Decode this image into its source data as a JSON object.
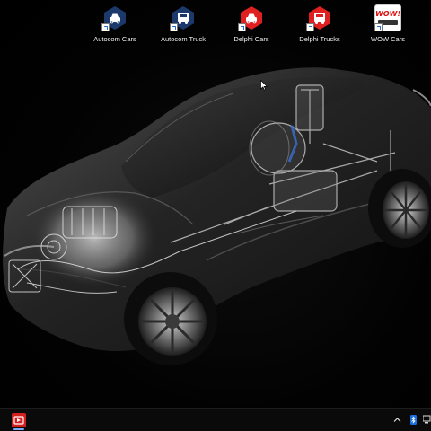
{
  "desktop": {
    "icons": [
      {
        "label": "Autocom Cars",
        "icon": "autocom-car-icon",
        "color": "#1b3a6b"
      },
      {
        "label": "Autocom Truck",
        "icon": "autocom-truck-icon",
        "color": "#1b3a6b"
      },
      {
        "label": "Delphi Cars",
        "icon": "delphi-car-icon",
        "color": "#e02020"
      },
      {
        "label": "Delphi Trucks",
        "icon": "delphi-truck-icon",
        "color": "#e02020"
      },
      {
        "label": "WOW Cars",
        "icon": "wow-logo-icon",
        "color": "#ffffff",
        "logo_text": "WOW!"
      }
    ],
    "wallpaper": "x-ray-sports-car"
  },
  "taskbar": {
    "pinned_app": "autocom-taskbar-icon",
    "tray": [
      "chevron-up-icon",
      "bluetooth-icon",
      "network-icon"
    ]
  }
}
